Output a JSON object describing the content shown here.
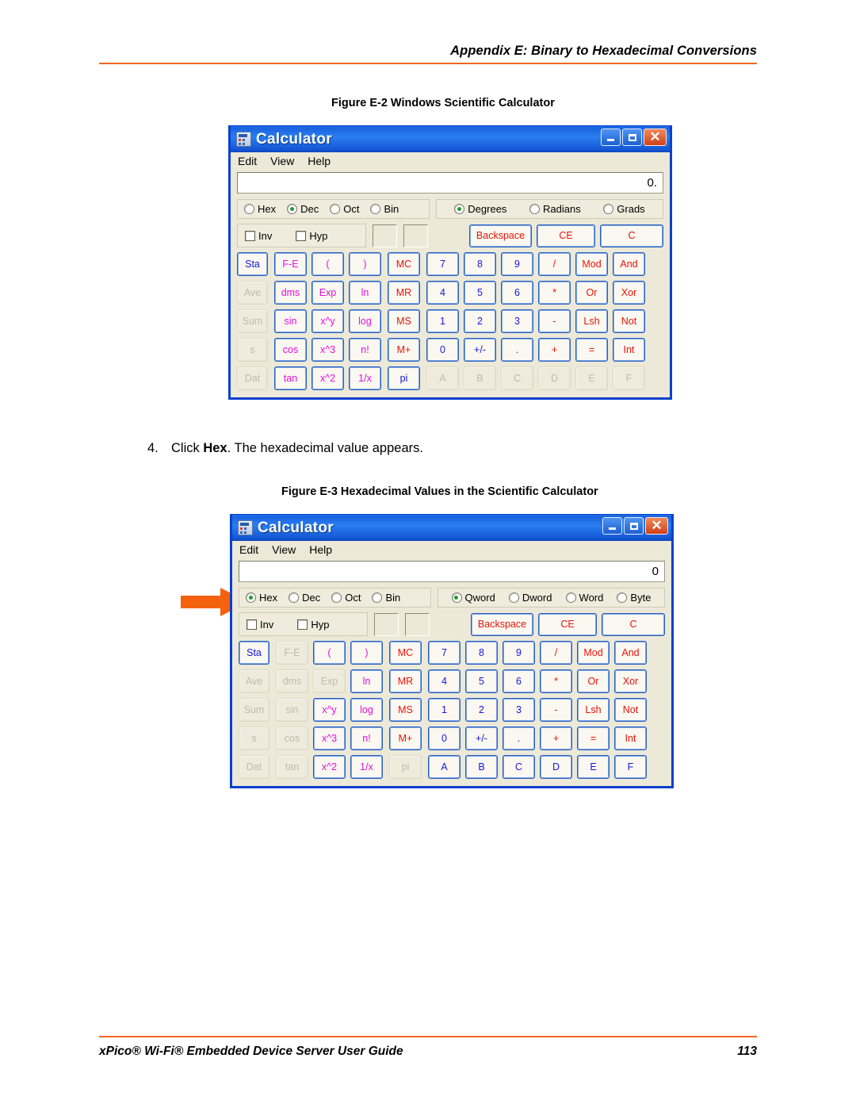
{
  "page": {
    "header_title": "Appendix E: Binary to Hexadecimal Conversions",
    "footer_title": "xPico® Wi-Fi® Embedded Device Server User Guide",
    "page_number": "113",
    "accent_color": "#f26722"
  },
  "figures": {
    "fig2_caption": "Figure E-2  Windows Scientific Calculator",
    "fig3_caption": "Figure E-3  Hexadecimal Values in the Scientific Calculator"
  },
  "step": {
    "number": "4.",
    "text_before": "Click ",
    "bold": "Hex",
    "text_after": ". The hexadecimal value appears."
  },
  "calculator1": {
    "window_title": "Calculator",
    "menu": [
      "Edit",
      "View",
      "Help"
    ],
    "display_value": "0.",
    "base_options": [
      "Hex",
      "Dec",
      "Oct",
      "Bin"
    ],
    "base_selected": "Dec",
    "mode_options": [
      "Degrees",
      "Radians",
      "Grads"
    ],
    "mode_selected": "Degrees",
    "checkboxes": [
      "Inv",
      "Hyp"
    ],
    "top_buttons": [
      "Backspace",
      "CE",
      "C"
    ],
    "col_left": [
      "Sta",
      "Ave",
      "Sum",
      "s",
      "Dat"
    ],
    "fn_grid": [
      "F-E",
      "(",
      ")",
      "dms",
      "Exp",
      "ln",
      "sin",
      "x^y",
      "log",
      "cos",
      "x^3",
      "n!",
      "tan",
      "x^2",
      "1/x"
    ],
    "mem_col": [
      "MC",
      "MR",
      "MS",
      "M+",
      "pi"
    ],
    "num_grid": [
      "7",
      "8",
      "9",
      "/",
      "Mod",
      "And",
      "4",
      "5",
      "6",
      "*",
      "Or",
      "Xor",
      "1",
      "2",
      "3",
      "-",
      "Lsh",
      "Not",
      "0",
      "+/-",
      ".",
      "+",
      "=",
      "Int",
      "A",
      "B",
      "C",
      "D",
      "E",
      "F"
    ],
    "window_buttons": [
      "minimize",
      "maximize",
      "close"
    ]
  },
  "calculator2": {
    "window_title": "Calculator",
    "menu": [
      "Edit",
      "View",
      "Help"
    ],
    "display_value": "0",
    "base_options": [
      "Hex",
      "Dec",
      "Oct",
      "Bin"
    ],
    "base_selected": "Hex",
    "mode_options": [
      "Qword",
      "Dword",
      "Word",
      "Byte"
    ],
    "mode_selected": "Qword",
    "checkboxes": [
      "Inv",
      "Hyp"
    ],
    "top_buttons": [
      "Backspace",
      "CE",
      "C"
    ],
    "col_left": [
      "Sta",
      "Ave",
      "Sum",
      "s",
      "Dat"
    ],
    "fn_grid": [
      "F-E",
      "(",
      ")",
      "dms",
      "Exp",
      "ln",
      "sin",
      "x^y",
      "log",
      "cos",
      "x^3",
      "n!",
      "tan",
      "x^2",
      "1/x"
    ],
    "mem_col": [
      "MC",
      "MR",
      "MS",
      "M+",
      "pi"
    ],
    "num_grid": [
      "7",
      "8",
      "9",
      "/",
      "Mod",
      "And",
      "4",
      "5",
      "6",
      "*",
      "Or",
      "Xor",
      "1",
      "2",
      "3",
      "-",
      "Lsh",
      "Not",
      "0",
      "+/-",
      ".",
      "+",
      "=",
      "Int",
      "A",
      "B",
      "C",
      "D",
      "E",
      "F"
    ],
    "window_buttons": [
      "minimize",
      "maximize",
      "close"
    ]
  }
}
